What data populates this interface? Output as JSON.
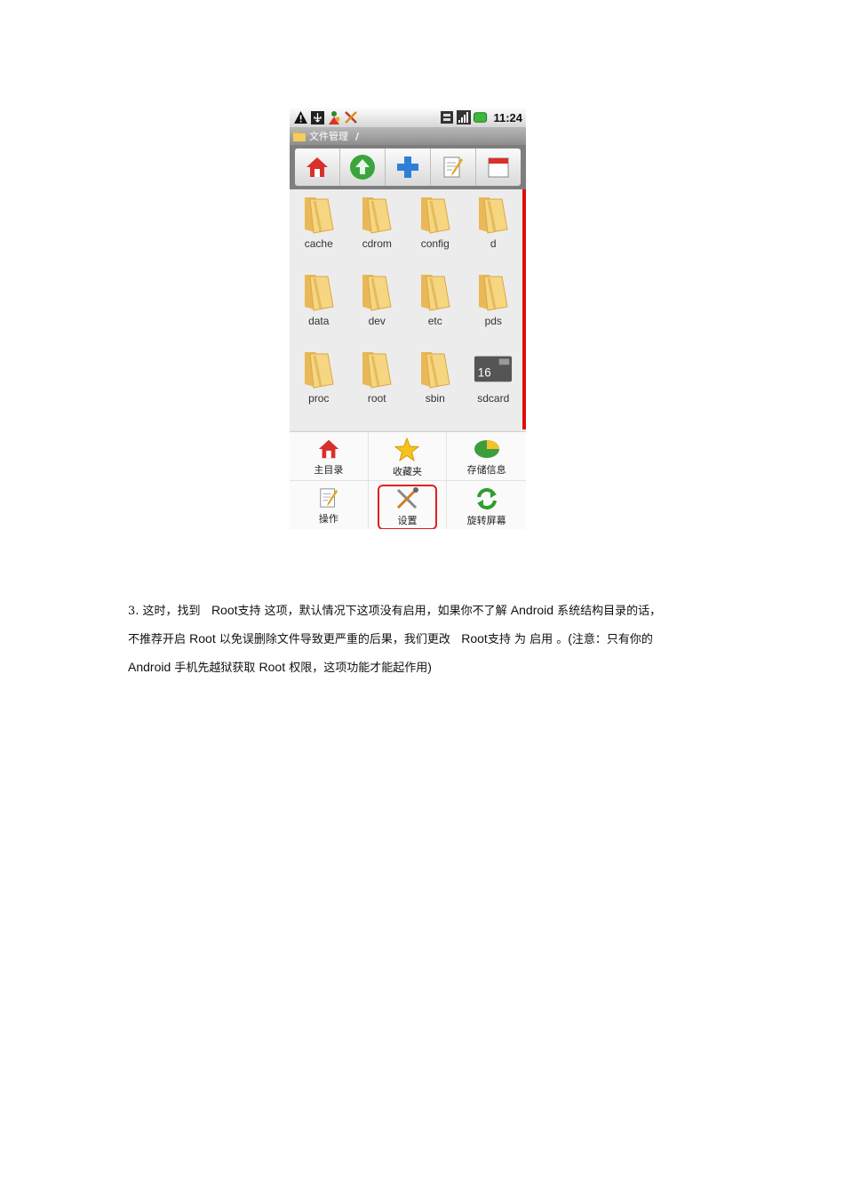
{
  "phone": {
    "status_bar": {
      "icons": [
        "warning-icon",
        "usb-icon",
        "app-notification-icon",
        "tools-notification-icon",
        "sim-icon",
        "signal-icon",
        "battery-icon"
      ],
      "time": "11:24"
    },
    "title_bar": {
      "app_name": "文件管理",
      "path": "/"
    },
    "toolbar": {
      "buttons": [
        "home-icon",
        "up-icon",
        "add-icon",
        "edit-icon",
        "calendar-icon"
      ]
    },
    "files": [
      {
        "name": "cache",
        "type": "folder"
      },
      {
        "name": "cdrom",
        "type": "folder"
      },
      {
        "name": "config",
        "type": "folder"
      },
      {
        "name": "d",
        "type": "folder"
      },
      {
        "name": "data",
        "type": "folder"
      },
      {
        "name": "dev",
        "type": "folder"
      },
      {
        "name": "etc",
        "type": "folder"
      },
      {
        "name": "pds",
        "type": "folder"
      },
      {
        "name": "proc",
        "type": "folder"
      },
      {
        "name": "root",
        "type": "folder"
      },
      {
        "name": "sbin",
        "type": "folder"
      },
      {
        "name": "sdcard",
        "type": "sdcard",
        "badge": "16"
      }
    ],
    "menu": [
      {
        "label": "主目录",
        "icon": "home-icon"
      },
      {
        "label": "收藏夹",
        "icon": "star-icon"
      },
      {
        "label": "存储信息",
        "icon": "storage-icon"
      },
      {
        "label": "操作",
        "icon": "edit-icon"
      },
      {
        "label": "设置",
        "icon": "settings-icon",
        "highlighted": true
      },
      {
        "label": "旋转屏幕",
        "icon": "rotate-icon"
      }
    ],
    "colors": {
      "scroll_indicator": "#e00c0c",
      "highlight_border": "#e02020",
      "folder": "#f3c968"
    }
  },
  "paragraph": {
    "line1_a": "3. 这时，找到 ",
    "line1_b": "Root",
    "line1_c": "支持 这项，默认情况下这项没有启用，如果你不了解 ",
    "line1_d": "Android",
    "line1_e": " 系统结构目录的话，",
    "line2_a": "不推荐开启 ",
    "line2_b": "Root",
    "line2_c": " 以免误删除文件导致更严重的后果，我们更改 ",
    "line2_d": "Root",
    "line2_e": "支持 为 启用 。",
    "line2_f": "(",
    "line2_g": "注意：只有你的",
    "line3_a": "Android",
    "line3_b": " 手机先越狱获取 ",
    "line3_c": "Root",
    "line3_d": " 权限，这项功能才能起作用",
    "line3_e": ")"
  }
}
